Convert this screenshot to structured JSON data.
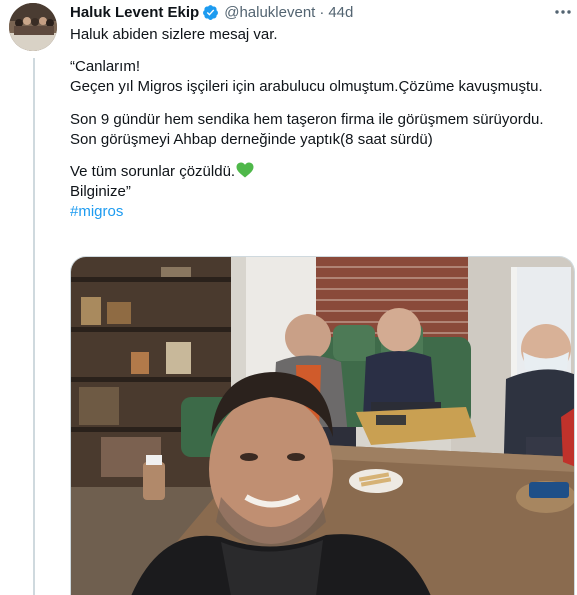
{
  "author": {
    "display_name": "Haluk Levent Ekip",
    "handle": "@haluklevent",
    "separator": "·",
    "time": "44d",
    "verified": true
  },
  "tweet": {
    "lines": [
      "Haluk abiden sizlere mesaj var.",
      "“Canlarım!",
      "Geçen yıl Migros işçileri için arabulucu olmuştum.Çözüme kavuşmuştu.",
      "Son 9 gündür hem sendika hem taşeron firma ile görüşmem sürüyordu.",
      "Son görüşmeyi Ahbap derneğinde yaptık(8 saat sürdü)",
      "Ve tüm sorunlar çözüldü.",
      "Bilginize”"
    ],
    "emoji": "green-heart",
    "hashtag": "#migros"
  },
  "icons": {
    "verified": "verified-badge-icon",
    "more": "more-options-icon"
  },
  "colors": {
    "link": "#1d9bf0",
    "secondary_text": "#536471",
    "verified_badge": "#1d9bf0",
    "heart": "#4fb84a"
  }
}
